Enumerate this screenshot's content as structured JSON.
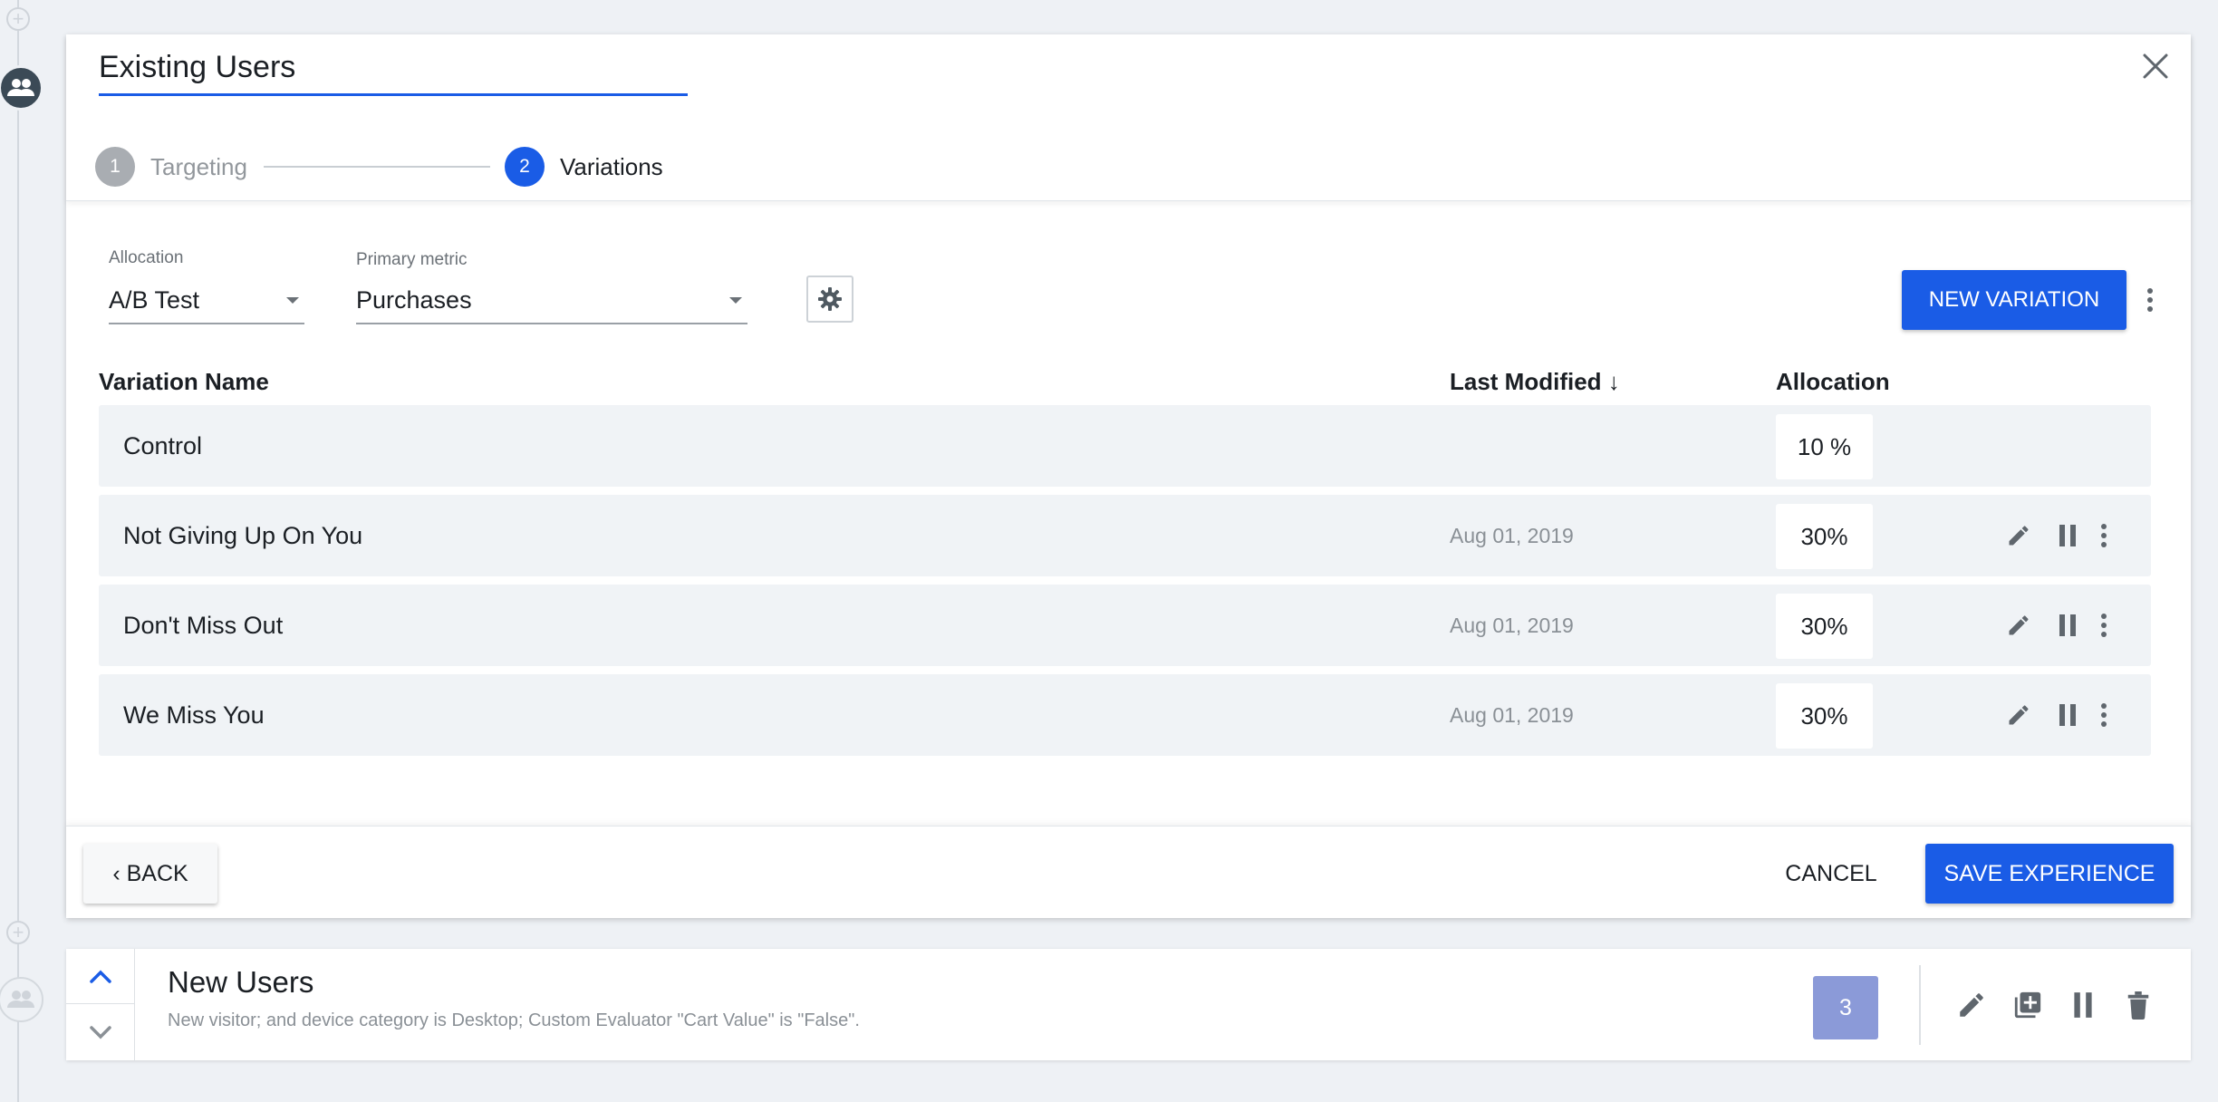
{
  "experience": {
    "name_value": "Existing Users",
    "steps": [
      {
        "number": "1",
        "label": "Targeting"
      },
      {
        "number": "2",
        "label": "Variations"
      }
    ]
  },
  "controls": {
    "allocation_label": "Allocation",
    "allocation_value": "A/B Test",
    "primary_metric_label": "Primary metric",
    "primary_metric_value": "Purchases",
    "new_variation_label": "NEW VARIATION"
  },
  "table": {
    "headers": {
      "name": "Variation Name",
      "modified": "Last Modified",
      "sort_glyph": "↓",
      "allocation": "Allocation"
    },
    "rows": [
      {
        "name": "Control",
        "modified": "",
        "allocation": "10 %"
      },
      {
        "name": "Not Giving Up On You",
        "modified": "Aug 01, 2019",
        "allocation": "30%"
      },
      {
        "name": "Don't Miss Out",
        "modified": "Aug 01, 2019",
        "allocation": "30%"
      },
      {
        "name": "We Miss You",
        "modified": "Aug 01, 2019",
        "allocation": "30%"
      }
    ]
  },
  "footer": {
    "back_label": "BACK",
    "cancel_label": "CANCEL",
    "save_label": "SAVE EXPERIENCE"
  },
  "next_experience": {
    "title": "New Users",
    "description": "New visitor; and device category is Desktop; Custom Evaluator \"Cart Value\" is \"False\".",
    "variation_count": "3"
  },
  "icons": {
    "close": "close-icon",
    "gear": "gear-icon",
    "edit": "pencil-icon",
    "pause": "pause-icon",
    "more": "more-vertical-icon",
    "duplicate": "duplicate-icon",
    "delete": "trash-icon",
    "chevron_up": "chevron-up-icon",
    "chevron_down": "chevron-down-icon",
    "users": "users-icon"
  },
  "colors": {
    "primary": "#1a5ce6",
    "count_badge": "#8b9ad8",
    "row_bg": "#f0f3f6",
    "page_bg": "#eef1f5"
  }
}
